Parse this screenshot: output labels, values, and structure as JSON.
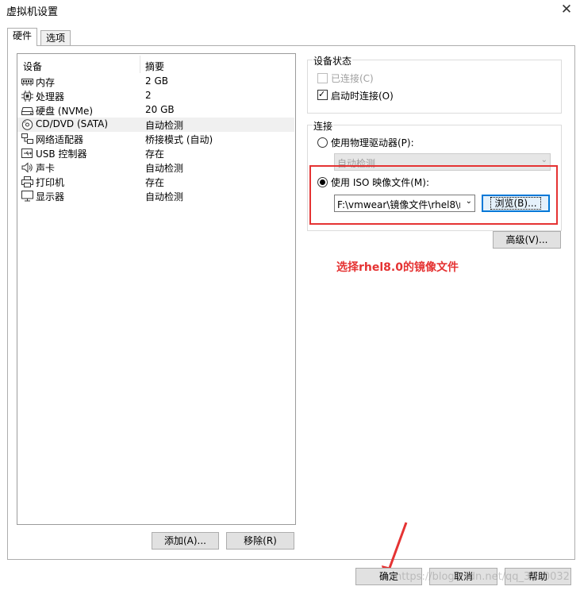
{
  "window": {
    "title": "虚拟机设置",
    "close_symbol": "✕"
  },
  "tabs": [
    {
      "label": "硬件",
      "active": true
    },
    {
      "label": "选项",
      "active": false
    }
  ],
  "device_list": {
    "col_device": "设备",
    "col_summary": "摘要",
    "items": [
      {
        "name": "内存",
        "summary": "2 GB",
        "icon": "memory-icon",
        "selected": false
      },
      {
        "name": "处理器",
        "summary": "2",
        "icon": "cpu-icon",
        "selected": false
      },
      {
        "name": "硬盘 (NVMe)",
        "summary": "20 GB",
        "icon": "disk-icon",
        "selected": false
      },
      {
        "name": "CD/DVD (SATA)",
        "summary": "自动检测",
        "icon": "cd-icon",
        "selected": true
      },
      {
        "name": "网络适配器",
        "summary": "桥接模式 (自动)",
        "icon": "network-icon",
        "selected": false
      },
      {
        "name": "USB 控制器",
        "summary": "存在",
        "icon": "usb-icon",
        "selected": false
      },
      {
        "name": "声卡",
        "summary": "自动检测",
        "icon": "speaker-icon",
        "selected": false
      },
      {
        "name": "打印机",
        "summary": "存在",
        "icon": "printer-icon",
        "selected": false
      },
      {
        "name": "显示器",
        "summary": "自动检测",
        "icon": "monitor-icon",
        "selected": false
      }
    ],
    "add_label": "添加(A)...",
    "remove_label": "移除(R)"
  },
  "device_status": {
    "title": "设备状态",
    "connected_label": "已连接(C)",
    "connected_checked": false,
    "connected_enabled": false,
    "connect_at_poweron_label": "启动时连接(O)",
    "connect_at_poweron_checked": true
  },
  "connection": {
    "title": "连接",
    "physical_label": "使用物理驱动器(P):",
    "physical_selected": false,
    "physical_value": "自动检测",
    "iso_label": "使用 ISO 映像文件(M):",
    "iso_selected": true,
    "iso_path": "F:\\vmwear\\镜像文件\\rhel8\\r",
    "browse_label": "浏览(B)..."
  },
  "advanced_label": "高级(V)...",
  "annotation": "选择rhel8.0的镜像文件",
  "footer": {
    "ok_label": "确定",
    "cancel_label": "取消",
    "help_label": "帮助"
  },
  "watermark": "https://blog.csdn.net/qq_38..0032",
  "colors": {
    "annotation_red": "#e53333",
    "focus_blue": "#0078d7"
  }
}
